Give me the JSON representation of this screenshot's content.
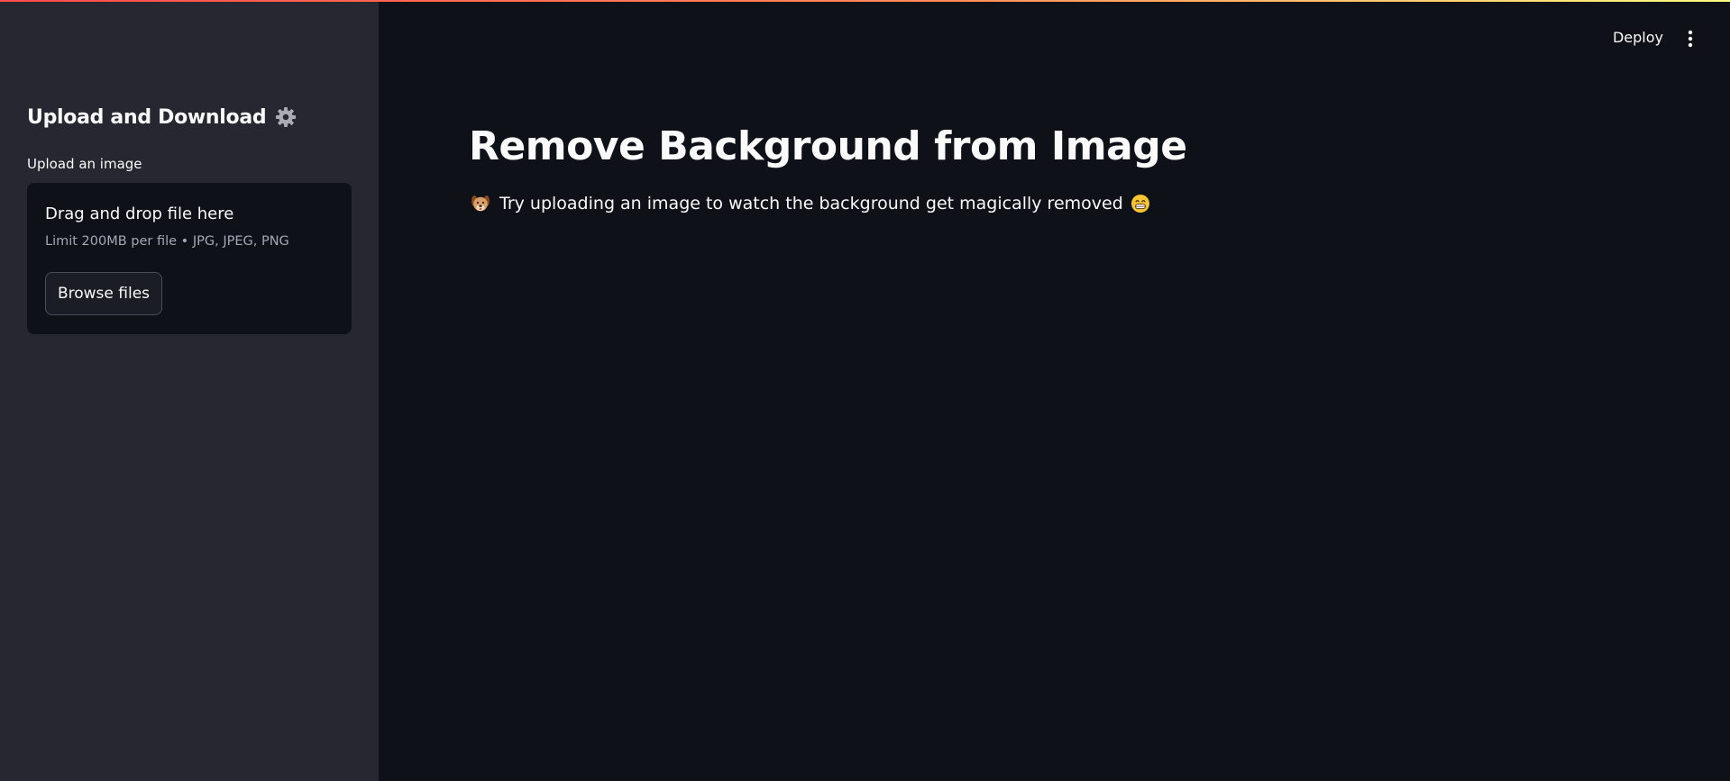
{
  "sidebar": {
    "title": "Upload and Download",
    "title_icon": "gear-icon",
    "uploader": {
      "label": "Upload an image",
      "drop_text": "Drag and drop file here",
      "limit_text": "Limit 200MB per file • JPG, JPEG, PNG",
      "browse_label": "Browse files"
    }
  },
  "header": {
    "deploy_label": "Deploy",
    "menu_icon": "vertical-dots-icon"
  },
  "main": {
    "title": "Remove Background from Image",
    "description": "Try uploading an image to watch the background get magically removed",
    "leading_icon": "dog-face-emoji",
    "trailing_icon": "grinning-face-emoji"
  },
  "colors": {
    "sidebar_bg": "#262730",
    "main_bg": "#0e1117",
    "text": "#fafafa",
    "muted_text": "#a3a8b4",
    "accent_start": "#ff4b4b",
    "accent_end": "#fffd80"
  }
}
